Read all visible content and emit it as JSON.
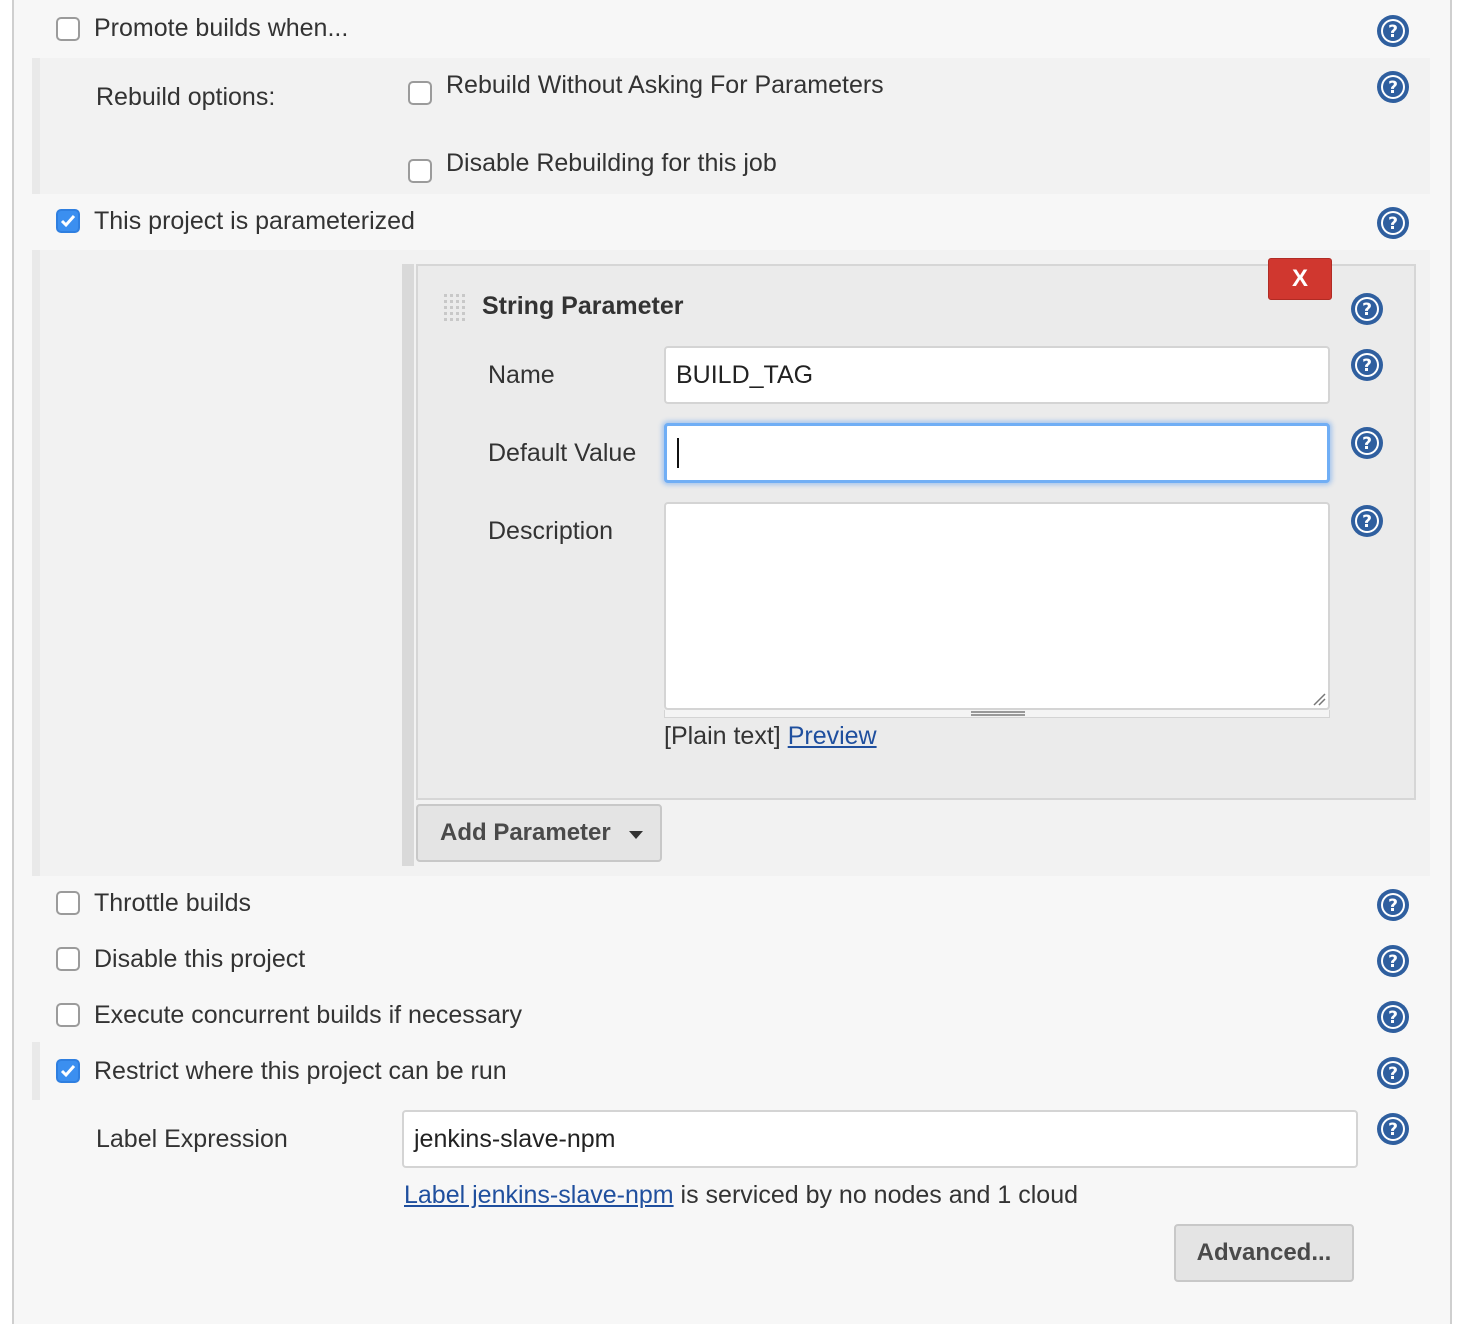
{
  "promote": {
    "label": "Promote builds when...",
    "checked": false
  },
  "rebuild": {
    "section_label": "Rebuild options:",
    "without_asking": {
      "label": "Rebuild Without Asking For Parameters",
      "checked": false
    },
    "disable_rebuilding": {
      "label": "Disable Rebuilding for this job",
      "checked": false
    }
  },
  "parameterized": {
    "label": "This project is parameterized",
    "checked": true
  },
  "string_parameter": {
    "title": "String Parameter",
    "delete_label": "X",
    "name_label": "Name",
    "name_value": "BUILD_TAG",
    "default_label": "Default Value",
    "default_value": "",
    "description_label": "Description",
    "description_value": "",
    "plain_text": "[Plain text]",
    "preview_link": "Preview"
  },
  "add_parameter": {
    "label": "Add Parameter",
    "icon": "caret-down-icon"
  },
  "throttle": {
    "label": "Throttle builds",
    "checked": false
  },
  "disable_project": {
    "label": "Disable this project",
    "checked": false
  },
  "concurrent": {
    "label": "Execute concurrent builds if necessary",
    "checked": false
  },
  "restrict": {
    "label": "Restrict where this project can be run",
    "checked": true
  },
  "label_expression": {
    "label": "Label Expression",
    "value": "jenkins-slave-npm",
    "status_link": "Label jenkins-slave-npm",
    "status_text": " is serviced by no nodes and 1 cloud"
  },
  "advanced": {
    "label": "Advanced..."
  },
  "colors": {
    "accent": "#3b8ff0",
    "help_icon": "#2f5f9f",
    "delete_button": "#d0372f",
    "link": "#1f4f9e",
    "focus_ring": "#70aef5"
  }
}
